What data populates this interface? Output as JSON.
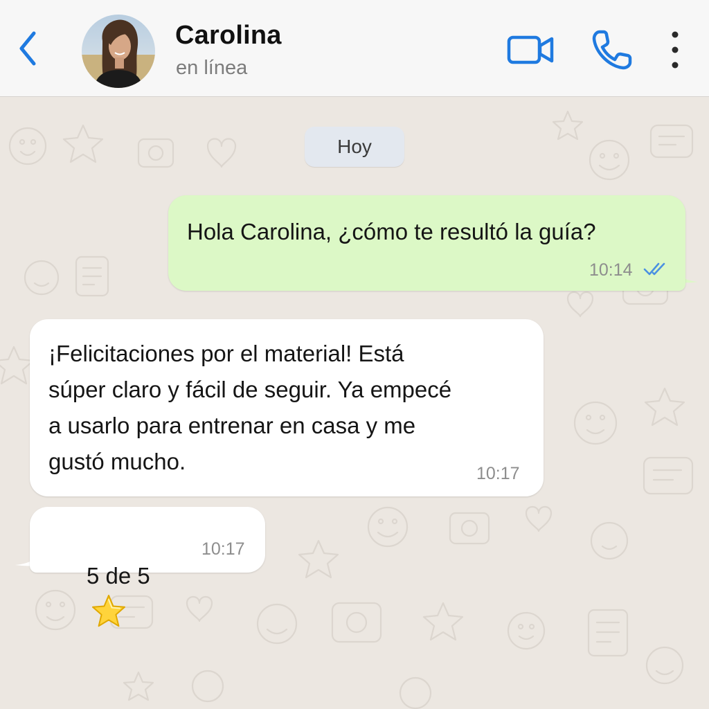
{
  "header": {
    "contact_name": "Carolina",
    "status": "en línea",
    "accent_color": "#1f7ae0",
    "icons": [
      "back-chevron-icon",
      "video-call-icon",
      "phone-call-icon",
      "more-vertical-icon"
    ]
  },
  "chat": {
    "date_label": "Hoy",
    "messages": [
      {
        "direction": "outgoing",
        "text": "Hola Carolina, ¿cómo te resultó la guía?",
        "time": "10:14",
        "status": "read",
        "bubble_color": "#dcf8c6",
        "check_color": "#4a90e2"
      },
      {
        "direction": "incoming",
        "text": "¡Felicitaciones por el material! Está\nsúper claro y fácil de seguir. Ya empecé\na usarlo para entrenar en casa y me\ngustó mucho.",
        "time": "10:17",
        "bubble_color": "#ffffff"
      },
      {
        "direction": "incoming",
        "text": "5 de 5",
        "emoji": "star-emoji-icon",
        "time": "10:17",
        "bubble_color": "#ffffff"
      }
    ]
  }
}
